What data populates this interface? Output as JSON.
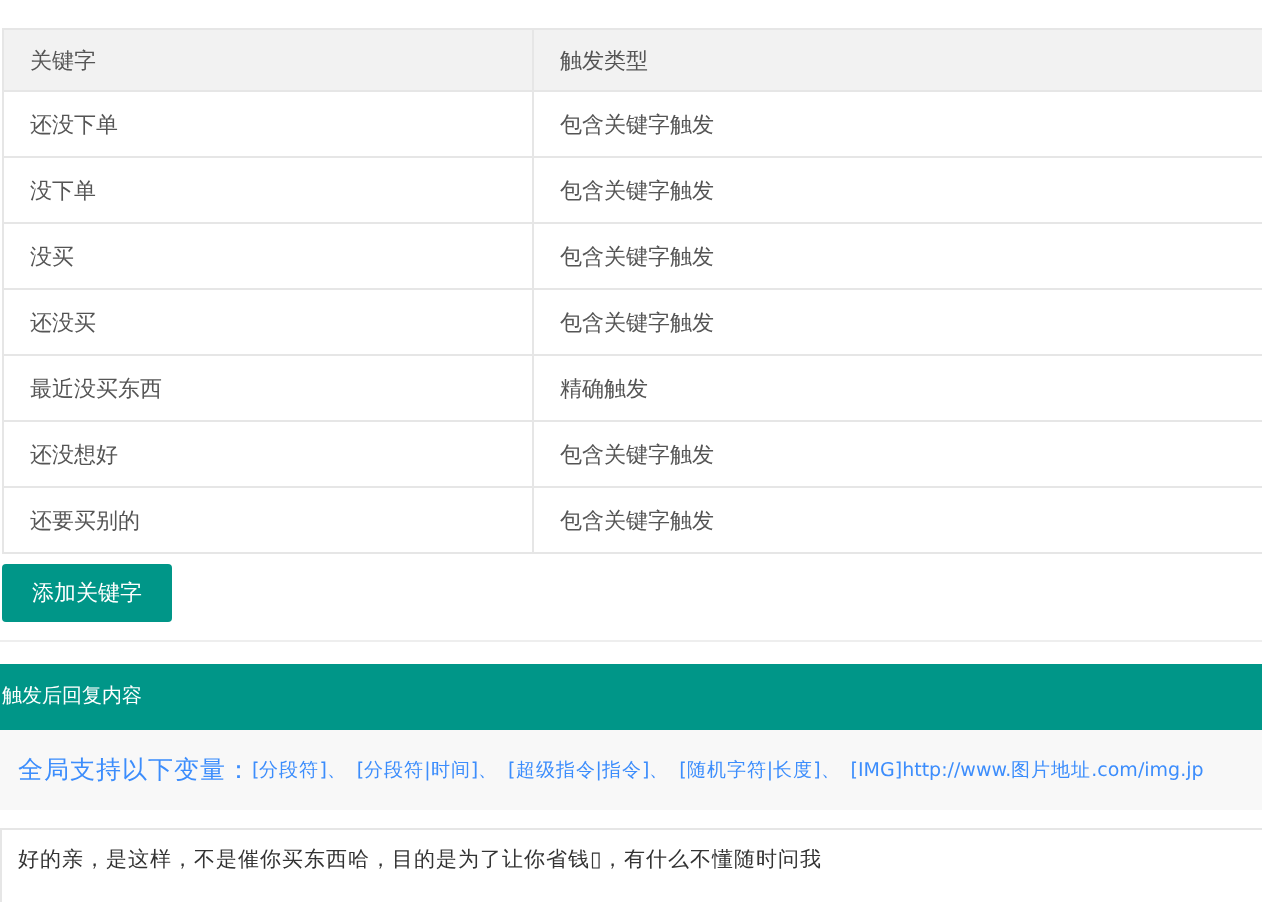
{
  "table": {
    "columns": [
      "关键字",
      "触发类型"
    ],
    "rows": [
      [
        "还没下单",
        "包含关键字触发"
      ],
      [
        "没下单",
        "包含关键字触发"
      ],
      [
        "没买",
        "包含关键字触发"
      ],
      [
        "还没买",
        "包含关键字触发"
      ],
      [
        "最近没买东西",
        "精确触发"
      ],
      [
        "还没想好",
        "包含关键字触发"
      ],
      [
        "还要买别的",
        "包含关键字触发"
      ]
    ]
  },
  "add_button": "添加关键字",
  "section": {
    "title": "触发后回复内容",
    "variables_label": "全局支持以下变量：",
    "variables": [
      "[分段符]",
      "[分段符|时间]",
      "[超级指令|指令]",
      "[随机字符|长度]",
      "[IMG]http://www.图片地址.com/img.jp"
    ],
    "separator": "、",
    "reply_text": "好的亲，是这样，不是催你买东西哈，目的是为了让你省钱▯，有什么不懂随时问我"
  }
}
